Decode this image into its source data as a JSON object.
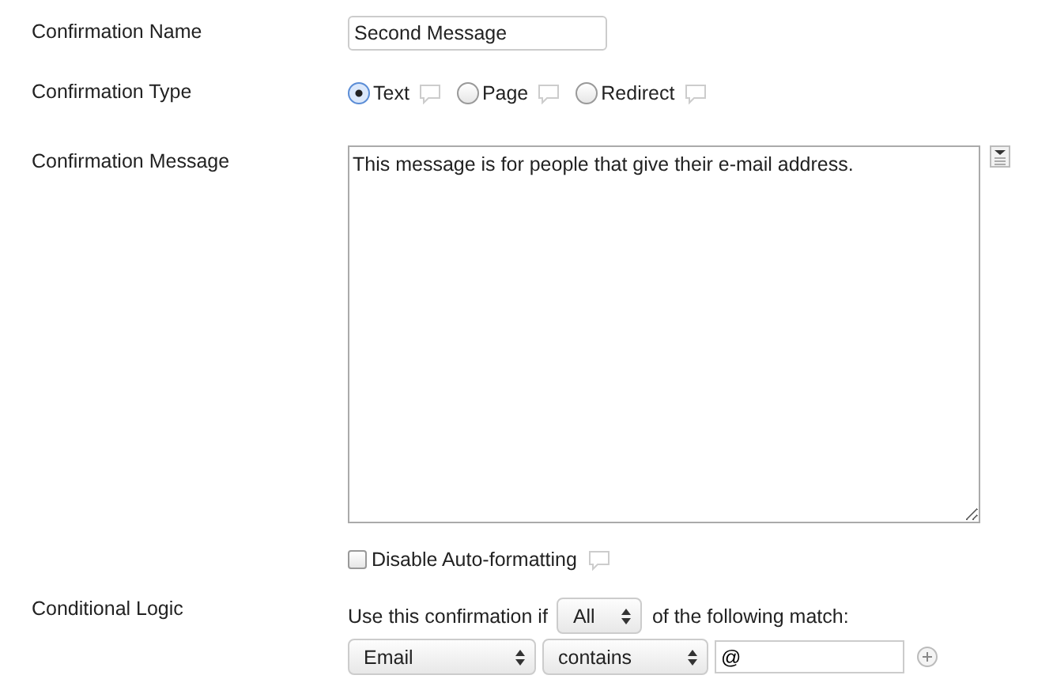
{
  "name_field": {
    "label": "Confirmation Name",
    "value": "Second Message"
  },
  "type_field": {
    "label": "Confirmation Type",
    "options": [
      {
        "label": "Text",
        "selected": true
      },
      {
        "label": "Page",
        "selected": false
      },
      {
        "label": "Redirect",
        "selected": false
      }
    ]
  },
  "message_field": {
    "label": "Confirmation Message",
    "value": "This message is for people that give their e-mail address."
  },
  "auto_format": {
    "label": "Disable Auto-formatting",
    "checked": false
  },
  "conditional_logic": {
    "label": "Conditional Logic",
    "prefix": "Use this confirmation if",
    "match": "All",
    "suffix": "of the following match:",
    "rules": [
      {
        "field": "Email",
        "operator": "contains",
        "value": "@"
      }
    ]
  }
}
